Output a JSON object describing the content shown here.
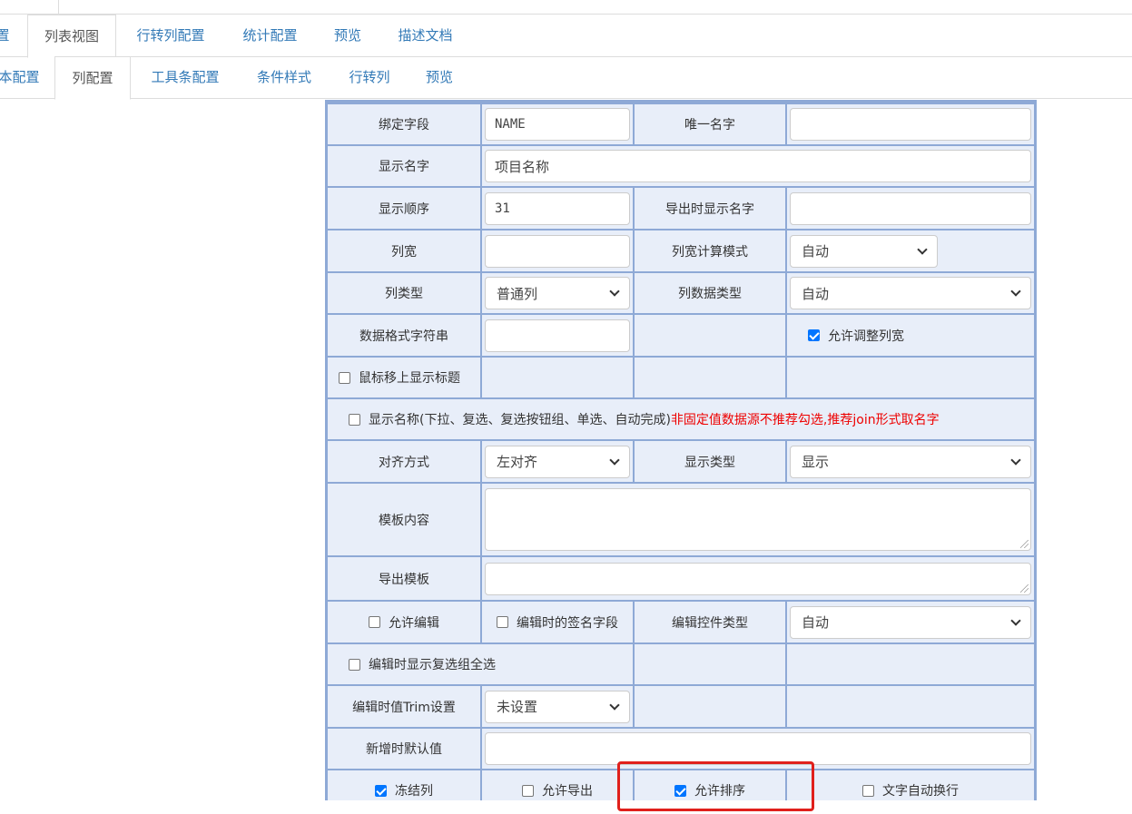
{
  "tabs_level1": [
    {
      "label": "置"
    },
    {
      "label": "列表视图",
      "active": true
    },
    {
      "label": "行转列配置"
    },
    {
      "label": "统计配置"
    },
    {
      "label": "预览"
    },
    {
      "label": "描述文档"
    }
  ],
  "tabs_level2": [
    {
      "label": "本配置"
    },
    {
      "label": "列配置",
      "active": true
    },
    {
      "label": "工具条配置"
    },
    {
      "label": "条件样式"
    },
    {
      "label": "行转列"
    },
    {
      "label": "预览"
    }
  ],
  "form": {
    "bind_field_label": "绑定字段",
    "bind_field_value": "NAME",
    "unique_name_label": "唯一名字",
    "unique_name_value": "",
    "display_name_label": "显示名字",
    "display_name_value": "项目名称",
    "display_order_label": "显示顺序",
    "display_order_value": "31",
    "export_display_name_label": "导出时显示名字",
    "export_display_name_value": "",
    "col_width_label": "列宽",
    "col_width_value": "",
    "col_width_mode_label": "列宽计算模式",
    "col_width_mode_value": "自动",
    "col_type_label": "列类型",
    "col_type_value": "普通列",
    "col_data_type_label": "列数据类型",
    "col_data_type_value": "自动",
    "data_format_label": "数据格式字符串",
    "data_format_value": "",
    "allow_resize_label": "允许调整列宽",
    "hover_title_label": "鼠标移上显示标题",
    "show_name_label": "显示名称(下拉、复选、复选按钮组、单选、自动完成)",
    "show_name_warning": "非固定值数据源不推荐勾选,推荐join形式取名字",
    "align_label": "对齐方式",
    "align_value": "左对齐",
    "display_type_label": "显示类型",
    "display_type_value": "显示",
    "template_label": "模板内容",
    "export_template_label": "导出模板",
    "allow_edit_label": "允许编辑",
    "sign_field_label": "编辑时的签名字段",
    "edit_control_type_label": "编辑控件类型",
    "edit_control_type_value": "自动",
    "edit_show_select_all_label": "编辑时显示复选组全选",
    "edit_trim_label": "编辑时值Trim设置",
    "edit_trim_value": "未设置",
    "default_value_label": "新增时默认值",
    "freeze_col_label": "冻结列",
    "allow_export_label": "允许导出",
    "allow_sort_label": "允许排序",
    "word_wrap_label": "文字自动换行"
  }
}
